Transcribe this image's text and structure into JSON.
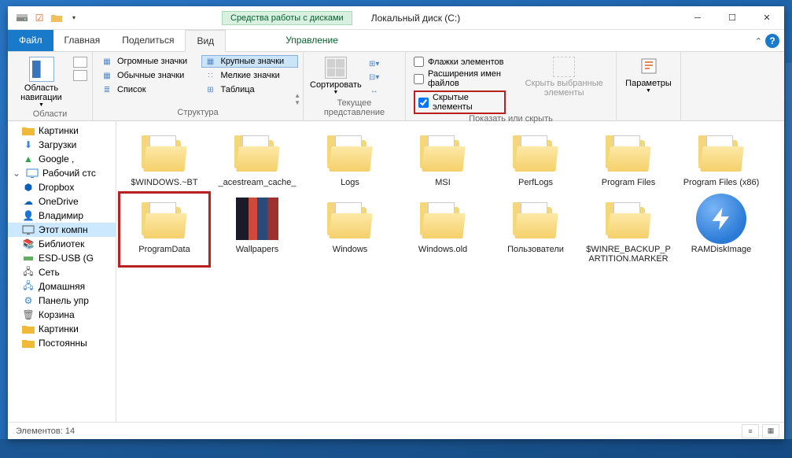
{
  "title": {
    "tools_tab": "Средства работы с дисками",
    "window": "Локальный диск (C:)"
  },
  "menu": {
    "file": "Файл",
    "home": "Главная",
    "share": "Поделиться",
    "view": "Вид",
    "manage": "Управление"
  },
  "ribbon": {
    "nav_pane": "Область навигации",
    "nav_group": "Области",
    "layout": {
      "huge": "Огромные значки",
      "large": "Крупные значки",
      "medium": "Обычные значки",
      "small": "Мелкие значки",
      "list": "Список",
      "tiles": "Таблица",
      "group": "Структура"
    },
    "sort": "Сортировать",
    "current_view_group": "Текущее представление",
    "checks": {
      "item_checkboxes": "Флажки элементов",
      "file_ext": "Расширения имен файлов",
      "hidden": "Скрытые элементы"
    },
    "hide_selected": "Скрыть выбранные элементы",
    "options": "Параметры",
    "show_hide_group": "Показать или скрыть"
  },
  "tree": [
    {
      "icon": "folder",
      "label": "Картинки",
      "color": "#f0b93a"
    },
    {
      "icon": "download",
      "label": "Загрузки",
      "color": "#3a88d0"
    },
    {
      "icon": "gdrive",
      "label": "Google ,",
      "color": "#28a745"
    },
    {
      "root": true,
      "icon": "pc",
      "label": "Рабочий стс",
      "color": "#3a88d0"
    },
    {
      "icon": "dropbox",
      "label": "Dropbox",
      "color": "#0a5fba"
    },
    {
      "icon": "cloud",
      "label": "OneDrive",
      "color": "#0a5fba"
    },
    {
      "icon": "user",
      "label": "Владимир",
      "color": "#d08040"
    },
    {
      "icon": "pc",
      "label": "Этот компн",
      "color": "#555",
      "sel": true
    },
    {
      "icon": "lib",
      "label": "Библиотек",
      "color": "#f0b93a"
    },
    {
      "icon": "usb",
      "label": "ESD-USB (G",
      "color": "#60b060"
    },
    {
      "icon": "net",
      "label": "Сеть",
      "color": "#555"
    },
    {
      "icon": "net",
      "label": "Домашняя",
      "color": "#3a88d0"
    },
    {
      "icon": "panel",
      "label": "Панель упр",
      "color": "#3a88d0"
    },
    {
      "icon": "bin",
      "label": "Корзина",
      "color": "#666"
    },
    {
      "icon": "folder",
      "label": "Картинки",
      "color": "#f0b93a"
    },
    {
      "icon": "folder",
      "label": "Постоянны",
      "color": "#f0b93a"
    }
  ],
  "folders": [
    {
      "name": "$WINDOWS.~BT",
      "type": "folder"
    },
    {
      "name": "_acestream_cache_",
      "type": "folder"
    },
    {
      "name": "Logs",
      "type": "folder"
    },
    {
      "name": "MSI",
      "type": "folder"
    },
    {
      "name": "PerfLogs",
      "type": "folder"
    },
    {
      "name": "Program Files",
      "type": "folder"
    },
    {
      "name": "Program Files (x86)",
      "type": "folder"
    },
    {
      "name": "ProgramData",
      "type": "folder",
      "highlight": true
    },
    {
      "name": "Wallpapers",
      "type": "wallpaper"
    },
    {
      "name": "Windows",
      "type": "folder"
    },
    {
      "name": "Windows.old",
      "type": "folder"
    },
    {
      "name": "Пользователи",
      "type": "folder"
    },
    {
      "name": "$WINRE_BACKUP_PARTITION.MARKER",
      "type": "folder"
    },
    {
      "name": "RAMDiskImage",
      "type": "ramdisk"
    }
  ],
  "status": {
    "items": "Элементов: 14"
  }
}
